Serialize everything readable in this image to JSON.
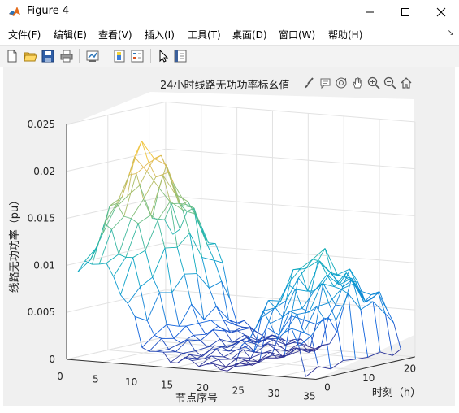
{
  "window": {
    "title": "Figure 4",
    "minimize_glyph": "—",
    "maximize_glyph": "☐",
    "close_glyph": "✕"
  },
  "menu": {
    "items": [
      "文件(F)",
      "编辑(E)",
      "查看(V)",
      "插入(I)",
      "工具(T)",
      "桌面(D)",
      "窗口(W)",
      "帮助(H)"
    ],
    "overflow_glyph": "↘"
  },
  "toolbar": {
    "icons": [
      "new-figure-icon",
      "open-file-icon",
      "save-icon",
      "print-icon",
      "link-plot-icon",
      "insert-colorbar-icon",
      "insert-legend-icon",
      "edit-plot-arrow-icon",
      "property-inspector-icon"
    ]
  },
  "axes_toolbar": {
    "icons": [
      "brush-icon",
      "data-tips-icon",
      "rotate-3d-icon",
      "pan-icon",
      "zoom-in-icon",
      "zoom-out-icon",
      "home-icon"
    ]
  },
  "chart_data": {
    "type": "surface",
    "title": "24小时线路无功功率标幺值",
    "title_visible": "24小时线路无功功率标幺值",
    "xlabel": "节点序号",
    "ylabel": "时刻（h）",
    "zlabel": "线路无功功率（pu）",
    "x_ticks": [
      0,
      5,
      10,
      15,
      20,
      25,
      30,
      35
    ],
    "y_ticks": [
      0,
      10,
      20
    ],
    "z_ticks": [
      0,
      0.005,
      0.01,
      0.015,
      0.02,
      0.025
    ],
    "z_tick_labels": [
      "0",
      "0.005",
      "0.01",
      "0.015",
      "0.02",
      "0.025"
    ],
    "xlim": [
      0,
      35
    ],
    "ylim": [
      0,
      24
    ],
    "zlim": [
      0,
      0.025
    ],
    "colormap": "parula",
    "grid": true,
    "line_profile_x": [
      1,
      2,
      3,
      4,
      5,
      6,
      7,
      8,
      9,
      10,
      11,
      12,
      13,
      14,
      15,
      16,
      17,
      18,
      19,
      20,
      21,
      22,
      23,
      24,
      25,
      26,
      27,
      28,
      29,
      30,
      31,
      32,
      33
    ],
    "peak_profile": [
      0.0175,
      0.0205,
      0.0225,
      0.0215,
      0.0195,
      0.0185,
      0.0165,
      0.0125,
      0.0085,
      0.0045,
      0.0035,
      0.0025,
      0.0025,
      0.0015,
      0.0012,
      0.0015,
      0.0015,
      0.0012,
      0.001,
      0.0006,
      0.0004,
      0.0003,
      0.0007,
      0.0045,
      0.0085,
      0.011,
      0.012,
      0.0105,
      0.0095,
      0.0095,
      0.0085,
      0.007,
      0.0008
    ],
    "time_hours": [
      1,
      4,
      7,
      10,
      13,
      16,
      19,
      22,
      24
    ]
  }
}
